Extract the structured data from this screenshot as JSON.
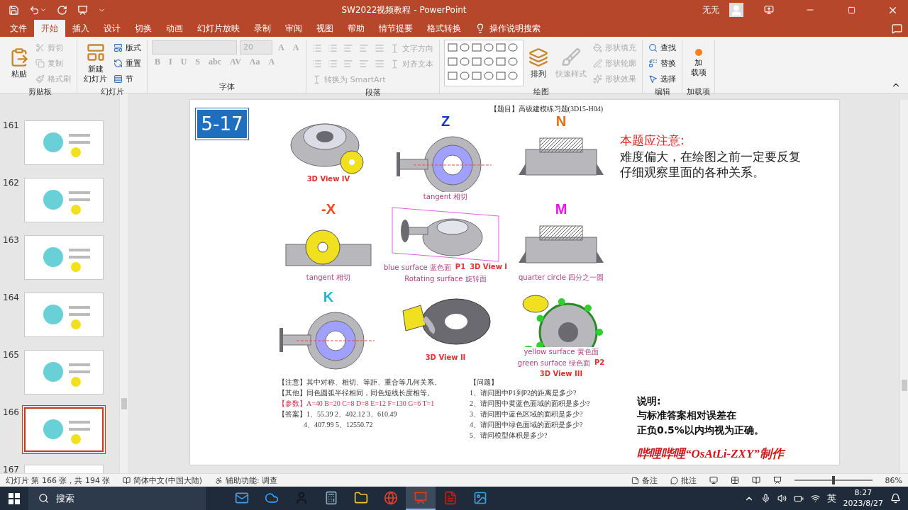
{
  "window": {
    "title": "SW2022视频教程  -  PowerPoint",
    "user": "无无"
  },
  "tabs": [
    {
      "label": "文件",
      "selected": false
    },
    {
      "label": "开始",
      "selected": true
    },
    {
      "label": "插入",
      "selected": false
    },
    {
      "label": "设计",
      "selected": false
    },
    {
      "label": "切换",
      "selected": false
    },
    {
      "label": "动画",
      "selected": false
    },
    {
      "label": "幻灯片放映",
      "selected": false
    },
    {
      "label": "录制",
      "selected": false
    },
    {
      "label": "审阅",
      "selected": false
    },
    {
      "label": "视图",
      "selected": false
    },
    {
      "label": "帮助",
      "selected": false
    },
    {
      "label": "情节提要",
      "selected": false
    },
    {
      "label": "格式转换",
      "selected": false
    }
  ],
  "tell_me": "操作说明搜索",
  "ribbon": [
    {
      "label": "剪贴板",
      "items": [
        {
          "kind": "large",
          "lines": [
            "粘贴"
          ],
          "disabled": false
        },
        {
          "kind": "small",
          "label": "剪切",
          "disabled": true
        },
        {
          "kind": "small",
          "label": "复制",
          "disabled": true
        },
        {
          "kind": "small",
          "label": "格式刷",
          "disabled": true
        }
      ]
    },
    {
      "label": "幻灯片",
      "items": [
        {
          "kind": "large",
          "lines": [
            "新建",
            "幻灯片"
          ],
          "disabled": false
        },
        {
          "kind": "small",
          "label": "版式",
          "disabled": false
        },
        {
          "kind": "small",
          "label": "重置",
          "disabled": false
        },
        {
          "kind": "small",
          "label": "节",
          "disabled": false
        }
      ]
    },
    {
      "label": "字体",
      "rows": [
        [
          {
            "kind": "field",
            "disabled": true
          },
          {
            "kind": "size",
            "label": "20",
            "disabled": true
          },
          {
            "kind": "glyph",
            "label": "A",
            "disabled": true
          },
          {
            "kind": "glyph",
            "label": "A",
            "disabled": true
          }
        ],
        [
          {
            "kind": "glyph",
            "label": "B",
            "disabled": true
          },
          {
            "kind": "glyph",
            "label": "I",
            "disabled": true
          },
          {
            "kind": "glyph",
            "label": "U",
            "disabled": true
          },
          {
            "kind": "glyph",
            "label": "S",
            "disabled": true
          },
          {
            "kind": "glyph",
            "label": "abc",
            "disabled": true
          },
          {
            "kind": "glyph",
            "label": "AV",
            "disabled": true
          },
          {
            "kind": "glyph",
            "label": "Aa",
            "disabled": true
          },
          {
            "kind": "glyph",
            "label": "A",
            "disabled": true
          }
        ]
      ]
    },
    {
      "label": "段落",
      "rows": [
        [
          {
            "kind": "icon",
            "disabled": true
          },
          {
            "kind": "icon",
            "disabled": true
          },
          {
            "kind": "icon",
            "disabled": true
          },
          {
            "kind": "icon",
            "disabled": true
          },
          {
            "kind": "icon",
            "disabled": true
          },
          {
            "kind": "small",
            "label": "文字方向",
            "disabled": true
          }
        ],
        [
          {
            "kind": "icon",
            "disabled": true
          },
          {
            "kind": "icon",
            "disabled": true
          },
          {
            "kind": "icon",
            "disabled": true
          },
          {
            "kind": "icon",
            "disabled": true
          },
          {
            "kind": "icon",
            "disabled": true
          },
          {
            "kind": "small",
            "label": "对齐文本",
            "disabled": true
          }
        ],
        [
          {
            "kind": "small",
            "label": "转换为 SmartArt",
            "disabled": true
          }
        ]
      ]
    },
    {
      "label": "绘图",
      "items": [
        {
          "kind": "gallery"
        },
        {
          "kind": "large",
          "lines": [
            "排列"
          ],
          "disabled": false
        },
        {
          "kind": "large",
          "lines": [
            "快速样式"
          ],
          "disabled": true
        },
        {
          "kind": "small",
          "label": "形状填充",
          "disabled": true
        },
        {
          "kind": "small",
          "label": "形状轮廓",
          "disabled": true
        },
        {
          "kind": "small",
          "label": "形状效果",
          "disabled": true
        }
      ]
    },
    {
      "label": "编辑",
      "items": [
        {
          "kind": "small",
          "label": "查找",
          "disabled": false
        },
        {
          "kind": "small",
          "label": "替换",
          "disabled": false
        },
        {
          "kind": "small",
          "label": "选择",
          "disabled": false
        }
      ]
    },
    {
      "label": "加载项",
      "items": [
        {
          "kind": "large",
          "lines": [
            "加",
            "载项"
          ],
          "disabled": false
        }
      ]
    }
  ],
  "slides": [
    {
      "number": "161",
      "selected": false
    },
    {
      "number": "162",
      "selected": false
    },
    {
      "number": "163",
      "selected": false
    },
    {
      "number": "164",
      "selected": false
    },
    {
      "number": "165",
      "selected": false
    },
    {
      "number": "166",
      "selected": true
    },
    {
      "number": "167",
      "selected": false
    }
  ],
  "slide": {
    "badge": "5-17",
    "drawing": {
      "title": "【题目】高级建模练习题(3D15-H04)",
      "views": [
        {
          "kind": "iso",
          "labels": [
            {
              "kind": "caption",
              "text": "3D View IV"
            }
          ]
        },
        {
          "kind": "top",
          "letter": "Z",
          "color": "#1a2fd8",
          "labels": [
            {
              "kind": "note",
              "text": "tangent 相切"
            }
          ]
        },
        {
          "kind": "section",
          "letter": "N",
          "color": "#e07010"
        },
        {
          "kind": "front",
          "letter": "-X",
          "color": "#f04a20",
          "labels": [
            {
              "kind": "note",
              "text": "tangent 相切"
            }
          ]
        },
        {
          "kind": "assembly",
          "labels": [
            {
              "kind": "note",
              "text": "blue surface 蓝色面"
            },
            {
              "kind": "caption",
              "text": "P1"
            },
            {
              "kind": "caption",
              "text": "3D View I"
            },
            {
              "kind": "note",
              "text": "Rotating surface 旋转面"
            }
          ]
        },
        {
          "kind": "section",
          "letter": "M",
          "color": "#ee10ee",
          "labels": [
            {
              "kind": "note",
              "text": "quarter circle 四分之一圆"
            }
          ]
        },
        {
          "kind": "top",
          "letter": "K",
          "color": "#20b8d0"
        },
        {
          "kind": "cutaway",
          "labels": [
            {
              "kind": "caption",
              "text": "3D View II"
            }
          ]
        },
        {
          "kind": "green",
          "labels": [
            {
              "kind": "note",
              "text": "yellow surface 黄色面"
            },
            {
              "kind": "note",
              "text": "green surface 绿色面"
            },
            {
              "kind": "caption",
              "text": "P2"
            },
            {
              "kind": "caption",
              "text": "3D View III"
            }
          ]
        }
      ],
      "notes": [
        {
          "kind": "plain",
          "text": "【注意】其中对称、相切、等距、重合等几何关系。"
        },
        {
          "kind": "plain",
          "text": "【其他】同色圆弧半径相同，同色短线长度相等。"
        },
        {
          "kind": "param",
          "text": "【参数】A=40  B=20  C=8  D=8  E=12  F=130  G=6  T=1"
        },
        {
          "kind": "plain",
          "text": "【答案】1、55.39   2、402.12   3、610.49"
        },
        {
          "kind": "indent",
          "text": "4、407.99  5、12550.72"
        }
      ],
      "questions": [
        "【问题】",
        "1、请问图中P1到P2的距离是多少?",
        "2、请问图中黄蓝色面域的面积是多少?",
        "3、请问图中蓝色区域的面积是多少?",
        "4、请问图中绿色面域的面积是多少?",
        "5、请问模型体积是多少?"
      ]
    },
    "attention_heading": "本题应注意:",
    "attention_body": "难度偏大，在绘图之前一定要反复仔细观察里面的各种关系。",
    "remark_heading": "说明:",
    "remark_lines": [
      "与标准答案相对误差在",
      "正负0.5%以内均视为正确。"
    ],
    "credit": "哔哩哔哩“OsAtLi-ZXY”制作"
  },
  "status_bar": {
    "slide_info": "幻灯片 第 166 张，共 194 张",
    "language": "简体中文(中国大陆)",
    "accessibility": "辅助功能: 调查",
    "notes": "备注",
    "comments": "批注",
    "zoom": {
      "level": 0.5,
      "reading": "86%"
    }
  },
  "taskbar": {
    "search": "搜索",
    "apps": [
      {
        "selected": false
      },
      {
        "selected": false
      },
      {
        "selected": false
      },
      {
        "selected": false
      },
      {
        "selected": false
      },
      {
        "selected": false
      },
      {
        "selected": true
      },
      {
        "selected": false
      },
      {
        "selected": false
      }
    ],
    "ime": "英",
    "time": "8:27",
    "date": "2023/8/27"
  }
}
